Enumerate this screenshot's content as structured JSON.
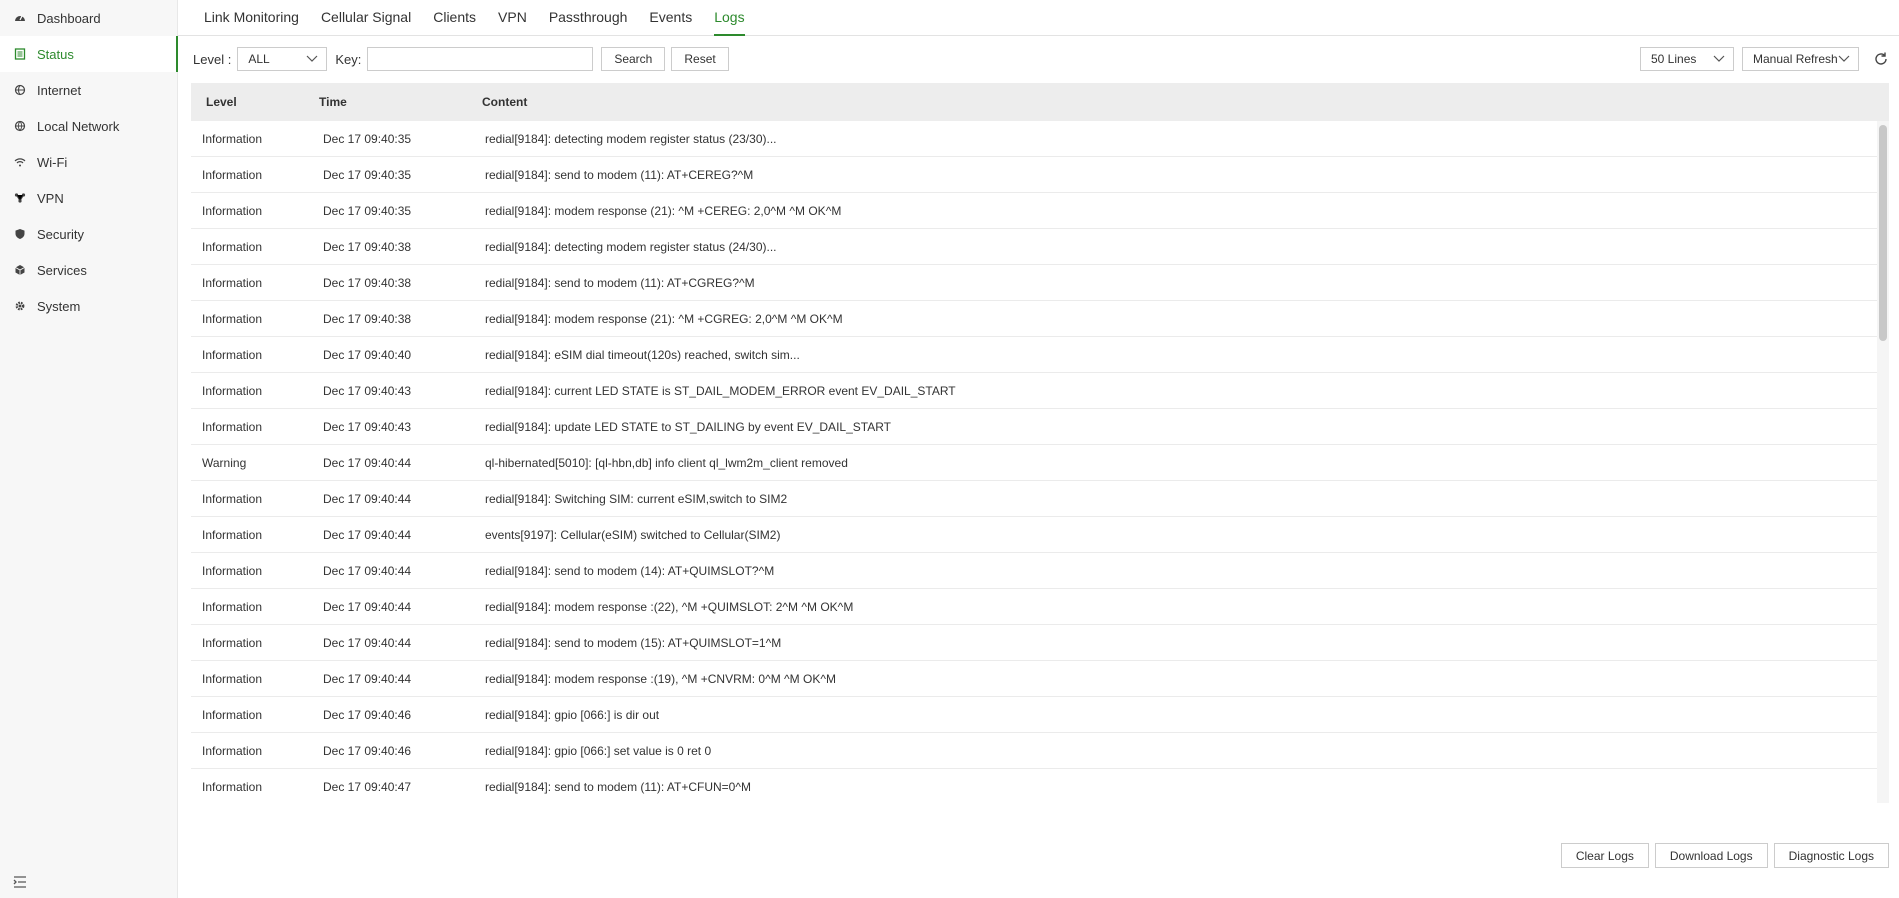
{
  "sidebar": {
    "items": [
      {
        "label": "Dashboard",
        "icon": "dashboard-icon"
      },
      {
        "label": "Status",
        "icon": "status-icon",
        "active": true
      },
      {
        "label": "Internet",
        "icon": "internet-icon"
      },
      {
        "label": "Local Network",
        "icon": "globe-icon"
      },
      {
        "label": "Wi-Fi",
        "icon": "wifi-icon"
      },
      {
        "label": "VPN",
        "icon": "vpn-icon"
      },
      {
        "label": "Security",
        "icon": "shield-icon"
      },
      {
        "label": "Services",
        "icon": "cube-icon"
      },
      {
        "label": "System",
        "icon": "gear-icon"
      }
    ],
    "collapse_icon": "menu-collapse-icon"
  },
  "tabs": [
    {
      "label": "Link Monitoring"
    },
    {
      "label": "Cellular Signal"
    },
    {
      "label": "Clients"
    },
    {
      "label": "VPN"
    },
    {
      "label": "Passthrough"
    },
    {
      "label": "Events"
    },
    {
      "label": "Logs",
      "active": true
    }
  ],
  "toolbar": {
    "level_label": "Level :",
    "level_value": "ALL",
    "key_label": "Key:",
    "key_value": "",
    "search_label": "Search",
    "reset_label": "Reset",
    "lines_value": "50 Lines",
    "refresh_mode_value": "Manual Refresh"
  },
  "table": {
    "headers": {
      "level": "Level",
      "time": "Time",
      "content": "Content"
    },
    "rows": [
      {
        "level": "Information",
        "time": "Dec 17 09:40:35",
        "content": "redial[9184]: detecting modem register status (23/30)..."
      },
      {
        "level": "Information",
        "time": "Dec 17 09:40:35",
        "content": "redial[9184]: send to modem (11): AT+CEREG?^M"
      },
      {
        "level": "Information",
        "time": "Dec 17 09:40:35",
        "content": "redial[9184]: modem response (21): ^M +CEREG: 2,0^M ^M OK^M"
      },
      {
        "level": "Information",
        "time": "Dec 17 09:40:38",
        "content": "redial[9184]: detecting modem register status (24/30)..."
      },
      {
        "level": "Information",
        "time": "Dec 17 09:40:38",
        "content": "redial[9184]: send to modem (11): AT+CGREG?^M"
      },
      {
        "level": "Information",
        "time": "Dec 17 09:40:38",
        "content": "redial[9184]: modem response (21): ^M +CGREG: 2,0^M ^M OK^M"
      },
      {
        "level": "Information",
        "time": "Dec 17 09:40:40",
        "content": "redial[9184]: eSIM dial timeout(120s) reached, switch sim..."
      },
      {
        "level": "Information",
        "time": "Dec 17 09:40:43",
        "content": "redial[9184]: current LED STATE is ST_DAIL_MODEM_ERROR event EV_DAIL_START"
      },
      {
        "level": "Information",
        "time": "Dec 17 09:40:43",
        "content": "redial[9184]: update LED STATE to ST_DAILING by event EV_DAIL_START"
      },
      {
        "level": "Warning",
        "time": "Dec 17 09:40:44",
        "content": "ql-hibernated[5010]: [ql-hbn,db] info client ql_lwm2m_client removed"
      },
      {
        "level": "Information",
        "time": "Dec 17 09:40:44",
        "content": "redial[9184]: Switching SIM: current eSIM,switch to SIM2"
      },
      {
        "level": "Information",
        "time": "Dec 17 09:40:44",
        "content": "events[9197]: Cellular(eSIM) switched to Cellular(SIM2)"
      },
      {
        "level": "Information",
        "time": "Dec 17 09:40:44",
        "content": "redial[9184]: send to modem (14): AT+QUIMSLOT?^M"
      },
      {
        "level": "Information",
        "time": "Dec 17 09:40:44",
        "content": "redial[9184]: modem response :(22), ^M +QUIMSLOT: 2^M ^M OK^M"
      },
      {
        "level": "Information",
        "time": "Dec 17 09:40:44",
        "content": "redial[9184]: send to modem (15): AT+QUIMSLOT=1^M"
      },
      {
        "level": "Information",
        "time": "Dec 17 09:40:44",
        "content": "redial[9184]: modem response :(19), ^M +CNVRM: 0^M ^M OK^M"
      },
      {
        "level": "Information",
        "time": "Dec 17 09:40:46",
        "content": "redial[9184]: gpio [066:] is dir out"
      },
      {
        "level": "Information",
        "time": "Dec 17 09:40:46",
        "content": "redial[9184]: gpio [066:] set value is 0 ret 0"
      },
      {
        "level": "Information",
        "time": "Dec 17 09:40:47",
        "content": "redial[9184]: send to modem (11): AT+CFUN=0^M"
      }
    ]
  },
  "footer": {
    "clear_label": "Clear Logs",
    "download_label": "Download Logs",
    "diagnostic_label": "Diagnostic Logs"
  },
  "colors": {
    "accent": "#2d8a2d",
    "header_bg": "#ededed",
    "sidebar_bg": "#f7f7f7"
  }
}
